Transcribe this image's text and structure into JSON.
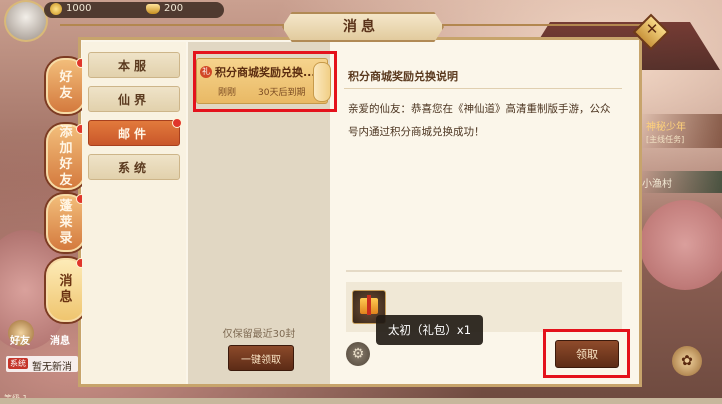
{
  "resources": {
    "copper": "1000",
    "gold": "200"
  },
  "window": {
    "title": "消息"
  },
  "side_tabs": [
    {
      "label": "好友",
      "badge": true,
      "active": false
    },
    {
      "label": "添加好友",
      "badge": true,
      "active": false
    },
    {
      "label": "蓬莱录",
      "badge": true,
      "active": false
    },
    {
      "label": "消息",
      "badge": true,
      "active": true
    }
  ],
  "categories": [
    {
      "label": "本服",
      "active": false,
      "badge": false
    },
    {
      "label": "仙界",
      "active": false,
      "badge": false
    },
    {
      "label": "邮件",
      "active": true,
      "badge": true
    },
    {
      "label": "系统",
      "active": false,
      "badge": false
    }
  ],
  "mail_list": [
    {
      "icon": "礼",
      "title": "积分商城奖励兑换...",
      "time": "刚刚",
      "expire": "30天后到期"
    }
  ],
  "keep_note": "仅保留最近30封",
  "claim_all_label": "一键领取",
  "detail": {
    "title": "积分商城奖励兑换说明",
    "body": "亲爱的仙友：恭喜您在《神仙道》高清重制版手游，公众号内通过积分商城兑换成功！",
    "attachment_tooltip": "太初（礼包）x1",
    "claim_label": "领取"
  },
  "hud": {
    "quest_title": "神秘少年",
    "quest_sub": "[主线任务]",
    "location": "小渔村",
    "friend_label": "好友",
    "message_label": "消息",
    "news_tag": "系统",
    "news_text": "暂无新消",
    "level_text": "等级 1"
  },
  "colors": {
    "accent": "#c9572a",
    "highlight": "#e4121c",
    "panel_bg": "#fbf6ea"
  }
}
